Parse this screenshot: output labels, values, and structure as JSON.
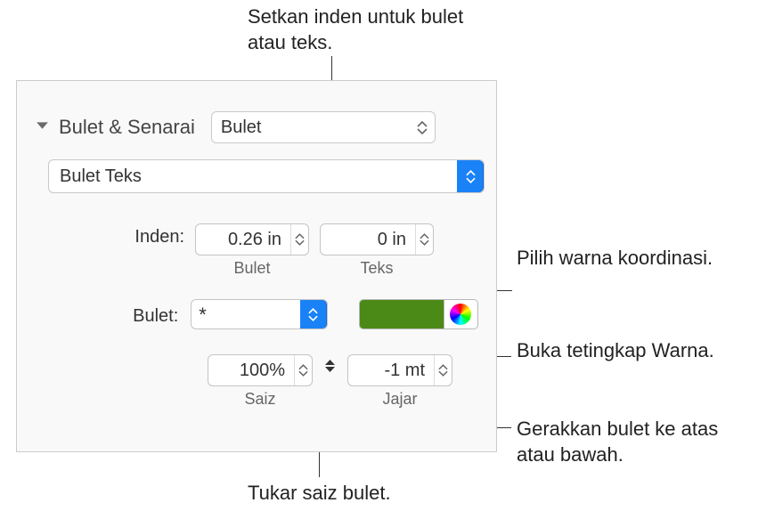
{
  "callouts": {
    "top": "Setkan inden untuk bulet atau teks.",
    "colorCoord": "Pilih warna koordinasi.",
    "openColor": "Buka tetingkap Warna.",
    "moveBullet": "Gerakkan bulet ke atas atau bawah.",
    "sizeBullet": "Tukar saiz bulet."
  },
  "section": {
    "title": "Bulet & Senarai"
  },
  "style_dropdown": "Bulet",
  "subtype_dropdown": "Bulet Teks",
  "inden": {
    "label": "Inden:",
    "bullet": {
      "value": "0.26 in",
      "caption": "Bulet"
    },
    "text": {
      "value": "0 in",
      "caption": "Teks"
    }
  },
  "bullet": {
    "label": "Bulet:",
    "glyph": "*",
    "color": "#4C8A17"
  },
  "size": {
    "value": "100%",
    "caption": "Saiz"
  },
  "align": {
    "value": "-1 mt",
    "caption": "Jajar"
  }
}
